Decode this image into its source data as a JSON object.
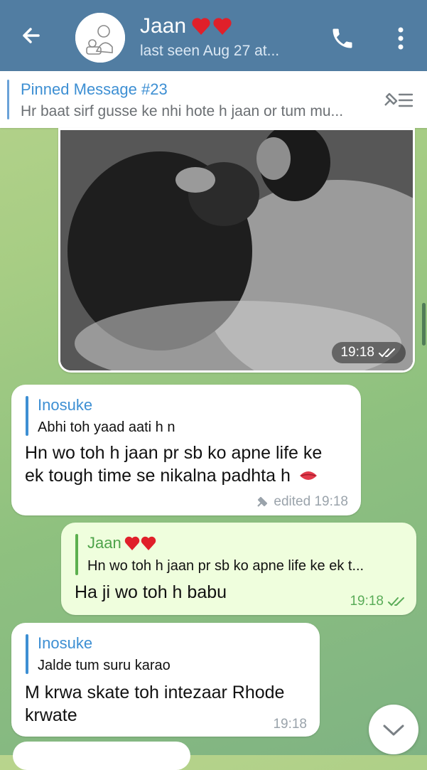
{
  "header": {
    "contact_name": "Jaan",
    "subtitle": "last seen Aug 27 at..."
  },
  "pinned": {
    "title": "Pinned Message #23",
    "preview": "Hr baat sirf gusse ke nhi hote h jaan or tum mu..."
  },
  "photo_message": {
    "time": "19:18"
  },
  "messages": [
    {
      "reply_name": "Inosuke",
      "reply_text": "Abhi toh yaad aati h n",
      "text_line1": "Hn wo toh h jaan pr sb ko apne life ke",
      "text_line2": "ek tough time se nikalna padhta h",
      "meta": "edited 19:18"
    },
    {
      "reply_name": "Jaan",
      "reply_text": "Hn wo toh h jaan pr sb ko apne life ke ek t...",
      "text": "Ha ji wo toh h babu",
      "meta": "19:18"
    },
    {
      "reply_name": "Inosuke",
      "reply_text": "Jalde tum suru karao",
      "text_line1": "M krwa skate toh intezaar Rhode",
      "text_line2": "krwate",
      "meta": "19:18"
    }
  ],
  "colors": {
    "header": "#517da2",
    "link": "#3d8fd3",
    "outgoing_bubble": "#effedd",
    "outgoing_accent": "#5cb04f",
    "heart": "#e0202a"
  },
  "icons": [
    "back-arrow-icon",
    "phone-icon",
    "more-vertical-icon",
    "unpin-list-icon",
    "double-check-icon",
    "pin-icon",
    "kiss-emoji-icon",
    "chevron-down-icon",
    "heart-icon"
  ]
}
